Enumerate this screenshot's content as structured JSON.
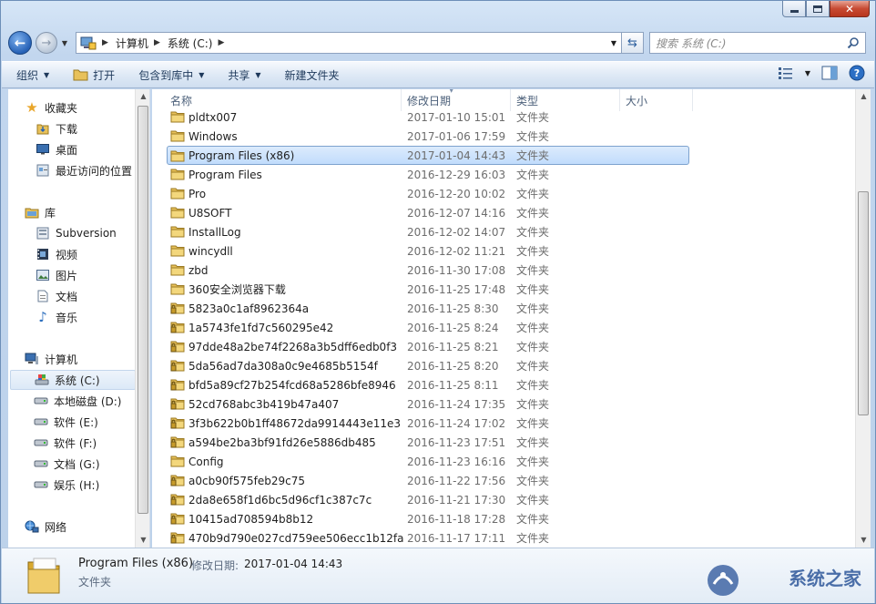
{
  "window": {
    "address": [
      "计算机",
      "系统 (C:)"
    ],
    "search_placeholder": "搜索 系统 (C:)"
  },
  "toolbar": {
    "organize": "组织",
    "open": "打开",
    "include_in_library": "包含到库中",
    "share": "共享",
    "new_folder": "新建文件夹"
  },
  "nav": {
    "favorites": "收藏夹",
    "downloads": "下载",
    "desktop": "桌面",
    "recent": "最近访问的位置",
    "libraries": "库",
    "subversion": "Subversion",
    "videos": "视频",
    "pictures": "图片",
    "documents": "文档",
    "music": "音乐",
    "computer": "计算机",
    "drive_c": "系统 (C:)",
    "drive_d": "本地磁盘 (D:)",
    "drive_e": "软件 (E:)",
    "drive_f": "软件 (F:)",
    "drive_g": "文档 (G:)",
    "drive_h": "娱乐 (H:)",
    "network": "网络"
  },
  "columns": {
    "name": "名称",
    "date": "修改日期",
    "type": "类型",
    "size": "大小"
  },
  "files": [
    {
      "name": "pldtx007",
      "date": "2017-01-10 15:01",
      "type": "文件夹",
      "locked": false
    },
    {
      "name": "Windows",
      "date": "2017-01-06 17:59",
      "type": "文件夹",
      "locked": false
    },
    {
      "name": "Program Files (x86)",
      "date": "2017-01-04 14:43",
      "type": "文件夹",
      "locked": false
    },
    {
      "name": "Program Files",
      "date": "2016-12-29 16:03",
      "type": "文件夹",
      "locked": false
    },
    {
      "name": "Pro",
      "date": "2016-12-20 10:02",
      "type": "文件夹",
      "locked": false
    },
    {
      "name": "U8SOFT",
      "date": "2016-12-07 14:16",
      "type": "文件夹",
      "locked": false
    },
    {
      "name": "InstallLog",
      "date": "2016-12-02 14:07",
      "type": "文件夹",
      "locked": false
    },
    {
      "name": "wincydll",
      "date": "2016-12-02 11:21",
      "type": "文件夹",
      "locked": false
    },
    {
      "name": "zbd",
      "date": "2016-11-30 17:08",
      "type": "文件夹",
      "locked": false
    },
    {
      "name": "360安全浏览器下载",
      "date": "2016-11-25 17:48",
      "type": "文件夹",
      "locked": false
    },
    {
      "name": "5823a0c1af8962364a",
      "date": "2016-11-25 8:30",
      "type": "文件夹",
      "locked": true
    },
    {
      "name": "1a5743fe1fd7c560295e42",
      "date": "2016-11-25 8:24",
      "type": "文件夹",
      "locked": true
    },
    {
      "name": "97dde48a2be74f2268a3b5dff6edb0f3",
      "date": "2016-11-25 8:21",
      "type": "文件夹",
      "locked": true
    },
    {
      "name": "5da56ad7da308a0c9e4685b5154f",
      "date": "2016-11-25 8:20",
      "type": "文件夹",
      "locked": true
    },
    {
      "name": "bfd5a89cf27b254fcd68a5286bfe8946",
      "date": "2016-11-25 8:11",
      "type": "文件夹",
      "locked": true
    },
    {
      "name": "52cd768abc3b419b47a407",
      "date": "2016-11-24 17:35",
      "type": "文件夹",
      "locked": true
    },
    {
      "name": "3f3b622b0b1ff48672da9914443e11e3",
      "date": "2016-11-24 17:02",
      "type": "文件夹",
      "locked": true
    },
    {
      "name": "a594be2ba3bf91fd26e5886db485",
      "date": "2016-11-23 17:51",
      "type": "文件夹",
      "locked": true
    },
    {
      "name": "Config",
      "date": "2016-11-23 16:16",
      "type": "文件夹",
      "locked": false
    },
    {
      "name": "a0cb90f575feb29c75",
      "date": "2016-11-22 17:56",
      "type": "文件夹",
      "locked": true
    },
    {
      "name": "2da8e658f1d6bc5d96cf1c387c7c",
      "date": "2016-11-21 17:30",
      "type": "文件夹",
      "locked": true
    },
    {
      "name": "10415ad708594b8b12",
      "date": "2016-11-18 17:28",
      "type": "文件夹",
      "locked": true
    },
    {
      "name": "470b9d790e027cd759ee506ecc1b12fa",
      "date": "2016-11-17 17:11",
      "type": "文件夹",
      "locked": true
    }
  ],
  "selected_index": 2,
  "details": {
    "name": "Program Files (x86)",
    "date_label": "修改日期:",
    "date_value": "2017-01-04 14:43",
    "type": "文件夹"
  },
  "watermark": {
    "text": "系统之家"
  },
  "colors": {
    "accent": "#2661b6",
    "folder": "#e8c15a",
    "selection": "#c1dcfc"
  }
}
